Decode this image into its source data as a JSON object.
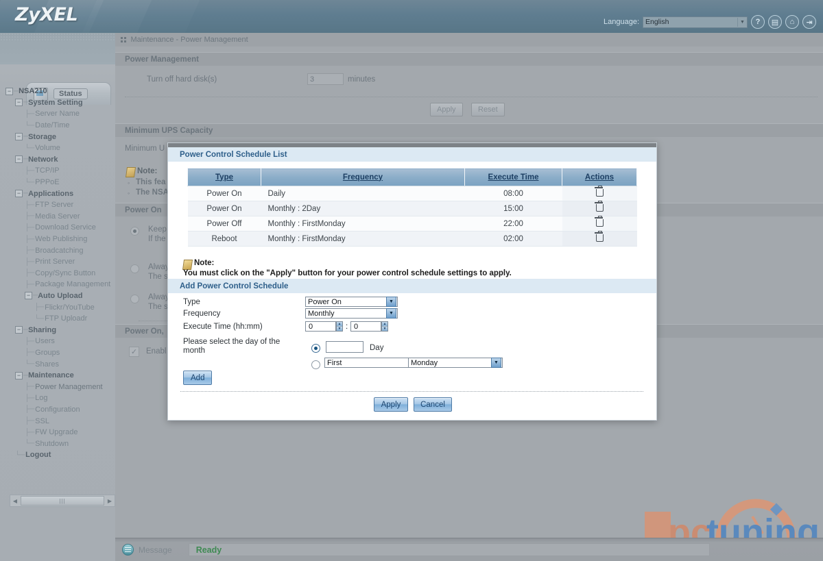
{
  "header": {
    "logo": "ZyXEL",
    "language_label": "Language:",
    "language_value": "English",
    "icons": [
      {
        "name": "help-icon",
        "glyph": "?"
      },
      {
        "name": "document-icon",
        "glyph": "▤"
      },
      {
        "name": "home-icon",
        "glyph": "⌂"
      },
      {
        "name": "logout-icon",
        "glyph": "⇥"
      }
    ]
  },
  "sidebar": {
    "status_tab": "Status",
    "tree": [
      {
        "label": "NSA210",
        "depth": 0,
        "kind": "root",
        "expander": true
      },
      {
        "label": "System Setting",
        "depth": 1,
        "kind": "cat",
        "expander": true
      },
      {
        "label": "Server Name",
        "depth": 2,
        "kind": "leaf",
        "branch": "tee"
      },
      {
        "label": "Date/Time",
        "depth": 2,
        "kind": "leaf",
        "branch": "end"
      },
      {
        "label": "Storage",
        "depth": 1,
        "kind": "cat",
        "expander": true
      },
      {
        "label": "Volume",
        "depth": 2,
        "kind": "leaf",
        "branch": "end"
      },
      {
        "label": "Network",
        "depth": 1,
        "kind": "cat",
        "expander": true
      },
      {
        "label": "TCP/IP",
        "depth": 2,
        "kind": "leaf",
        "branch": "tee"
      },
      {
        "label": "PPPoE",
        "depth": 2,
        "kind": "leaf",
        "branch": "end"
      },
      {
        "label": "Applications",
        "depth": 1,
        "kind": "cat",
        "expander": true
      },
      {
        "label": "FTP Server",
        "depth": 2,
        "kind": "leaf",
        "branch": "tee"
      },
      {
        "label": "Media Server",
        "depth": 2,
        "kind": "leaf",
        "branch": "tee"
      },
      {
        "label": "Download Service",
        "depth": 2,
        "kind": "leaf",
        "branch": "tee"
      },
      {
        "label": "Web Publishing",
        "depth": 2,
        "kind": "leaf",
        "branch": "tee"
      },
      {
        "label": "Broadcatching",
        "depth": 2,
        "kind": "leaf",
        "branch": "tee"
      },
      {
        "label": "Print Server",
        "depth": 2,
        "kind": "leaf",
        "branch": "tee"
      },
      {
        "label": "Copy/Sync Button",
        "depth": 2,
        "kind": "leaf",
        "branch": "tee"
      },
      {
        "label": "Package Management",
        "depth": 2,
        "kind": "leaf",
        "branch": "tee"
      },
      {
        "label": "Auto Upload",
        "depth": 2,
        "kind": "cat",
        "expander": true
      },
      {
        "label": "Flickr/YouTube",
        "depth": 3,
        "kind": "leaf",
        "branch": "tee"
      },
      {
        "label": "FTP Uploadr",
        "depth": 3,
        "kind": "leaf",
        "branch": "end"
      },
      {
        "label": "Sharing",
        "depth": 1,
        "kind": "cat",
        "expander": true
      },
      {
        "label": "Users",
        "depth": 2,
        "kind": "leaf",
        "branch": "tee"
      },
      {
        "label": "Groups",
        "depth": 2,
        "kind": "leaf",
        "branch": "tee"
      },
      {
        "label": "Shares",
        "depth": 2,
        "kind": "leaf",
        "branch": "end"
      },
      {
        "label": "Maintenance",
        "depth": 1,
        "kind": "cat",
        "expander": true
      },
      {
        "label": "Power Management",
        "depth": 2,
        "kind": "leaf",
        "branch": "tee",
        "selected": true
      },
      {
        "label": "Log",
        "depth": 2,
        "kind": "leaf",
        "branch": "tee"
      },
      {
        "label": "Configuration",
        "depth": 2,
        "kind": "leaf",
        "branch": "tee"
      },
      {
        "label": "SSL",
        "depth": 2,
        "kind": "leaf",
        "branch": "tee"
      },
      {
        "label": "FW Upgrade",
        "depth": 2,
        "kind": "leaf",
        "branch": "tee"
      },
      {
        "label": "Shutdown",
        "depth": 2,
        "kind": "leaf",
        "branch": "end"
      },
      {
        "label": "Logout",
        "depth": 1,
        "kind": "cat",
        "branch": "end"
      }
    ]
  },
  "breadcrumb": "Maintenance - Power Management",
  "page": {
    "section_power_management": "Power Management",
    "turn_off_label": "Turn off hard disk(s)",
    "turn_off_value": "3",
    "minutes_label": "minutes",
    "apply_label": "Apply",
    "reset_label": "Reset",
    "section_min_ups": "Minimum UPS Capacity",
    "min_ups_label": "Minimum U",
    "note_label": "Note:",
    "note_items": [
      "This fea",
      "The NSA"
    ],
    "section_power_on": "Power On",
    "power_on_options": [
      {
        "title": "Keep",
        "desc": "If the",
        "selected": true
      },
      {
        "title": "Alway",
        "desc": "The s",
        "selected": false
      },
      {
        "title": "Alway",
        "desc": "The s",
        "selected": false
      }
    ],
    "section_power_on_2": "Power On,",
    "enable_label": "Enabl",
    "watermark": "pctuning"
  },
  "modal": {
    "list_title": "Power Control Schedule List",
    "table": {
      "columns": [
        "Type",
        "Frequency",
        "Execute Time",
        "Actions"
      ],
      "rows": [
        {
          "type": "Power On",
          "frequency": "Daily",
          "time": "08:00",
          "action": "delete-icon"
        },
        {
          "type": "Power On",
          "frequency": "Monthly : 2Day",
          "time": "15:00",
          "action": "delete-icon"
        },
        {
          "type": "Power Off",
          "frequency": "Monthly : FirstMonday",
          "time": "22:00",
          "action": "delete-icon"
        },
        {
          "type": "Reboot",
          "frequency": "Monthly : FirstMonday",
          "time": "02:00",
          "action": "delete-icon"
        }
      ]
    },
    "note_label": "Note:",
    "note_text": "You must click on the \"Apply\" button for your power control schedule settings to apply.",
    "add_title": "Add Power Control Schedule",
    "form": {
      "type_label": "Type",
      "type_value": "Power On",
      "frequency_label": "Frequency",
      "frequency_value": "Monthly",
      "execute_time_label": "Execute Time (hh:mm)",
      "hour_value": "0",
      "minute_value": "0",
      "time_separator": ":",
      "day_of_month_label": "Please select the day of the month",
      "day_input_value": "",
      "day_suffix": "Day",
      "ordinal_value": "First",
      "weekday_value": "Monday",
      "add_label": "Add"
    },
    "apply_label": "Apply",
    "cancel_label": "Cancel"
  }
}
